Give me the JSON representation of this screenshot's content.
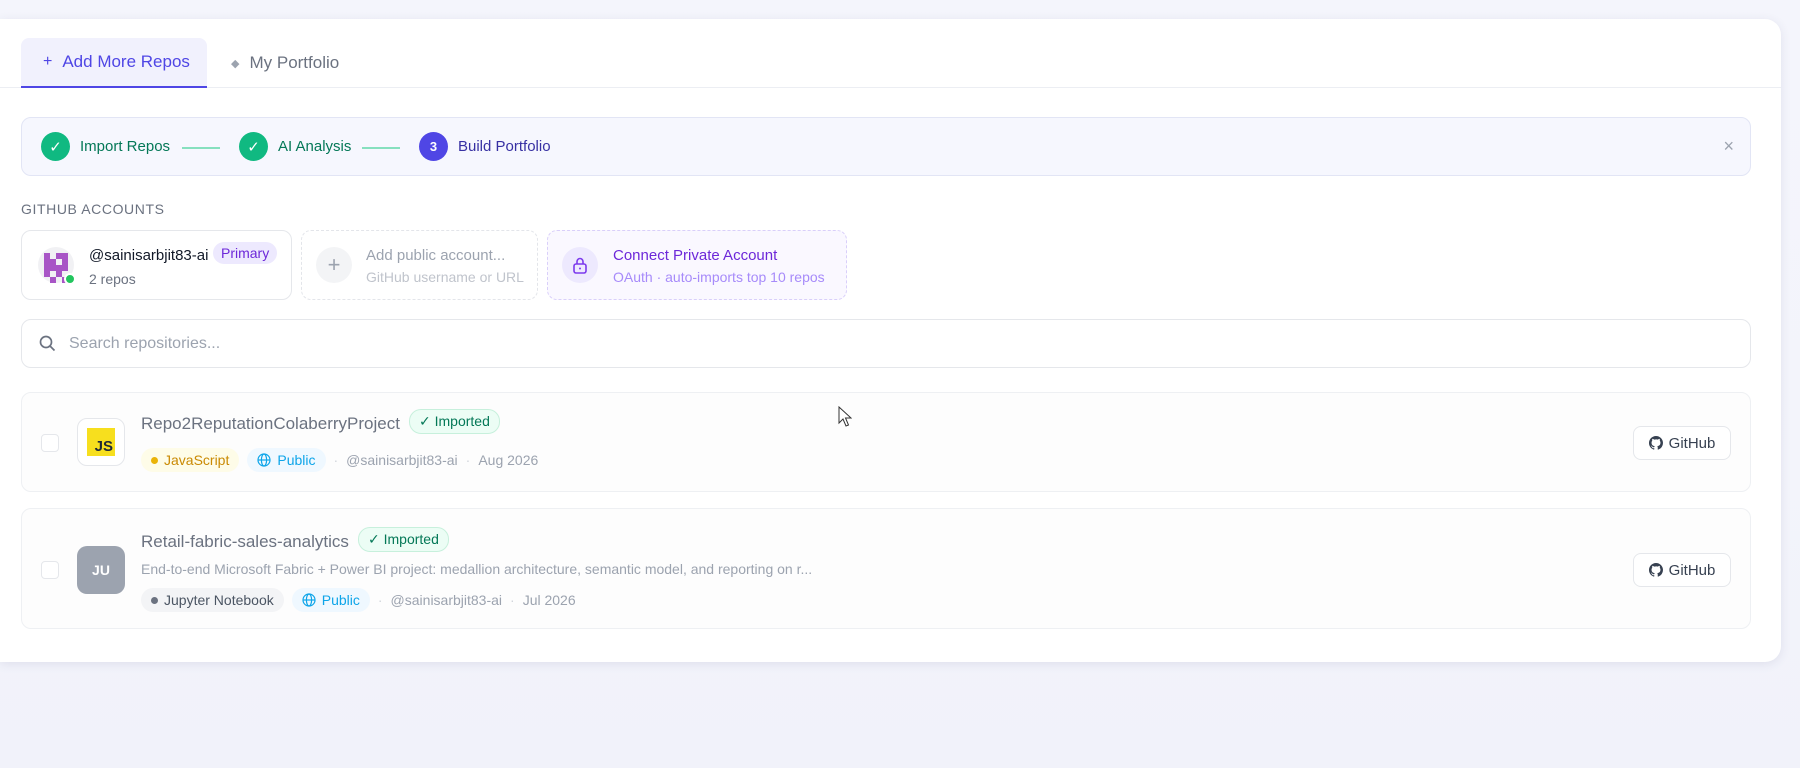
{
  "tabs": [
    {
      "icon": "+",
      "label": "Add More Repos",
      "active": true
    },
    {
      "icon": "◆",
      "label": "My Portfolio",
      "active": false
    }
  ],
  "stepper": {
    "steps": [
      {
        "marker": "✓",
        "label": "Import Repos",
        "state": "done"
      },
      {
        "marker": "✓",
        "label": "AI Analysis",
        "state": "done"
      },
      {
        "marker": "3",
        "label": "Build Portfolio",
        "state": "current"
      }
    ],
    "close": "×"
  },
  "accounts_section": {
    "label": "GITHUB ACCOUNTS",
    "primary": {
      "username": "@sainisarbjit83-ai",
      "badge": "Primary",
      "repos": "2 repos"
    },
    "add": {
      "icon": "+",
      "title": "Add public account...",
      "subtitle": "GitHub username or URL"
    },
    "private": {
      "title": "Connect Private Account",
      "subtitle": "OAuth · auto-imports top 10 repos"
    }
  },
  "search": {
    "placeholder": "Search repositories...",
    "value": ""
  },
  "repos": [
    {
      "name": "Repo2ReputationColaberryProject",
      "status": "✓ Imported",
      "icon_text": "JS",
      "description": "",
      "language": "JavaScript",
      "visibility": "Public",
      "owner": "@sainisarbjit83-ai",
      "date": "Aug 2026",
      "button": "GitHub"
    },
    {
      "name": "Retail-fabric-sales-analytics",
      "status": "✓ Imported",
      "icon_text": "JU",
      "description": "End-to-end Microsoft Fabric + Power BI project: medallion architecture, semantic model, and reporting on r...",
      "language": "Jupyter Notebook",
      "visibility": "Public",
      "owner": "@sainisarbjit83-ai",
      "date": "Jul 2026",
      "button": "GitHub"
    }
  ],
  "colors": {
    "accent": "#4f46e5",
    "success": "#10b981",
    "private_accent": "#7c3aed"
  }
}
